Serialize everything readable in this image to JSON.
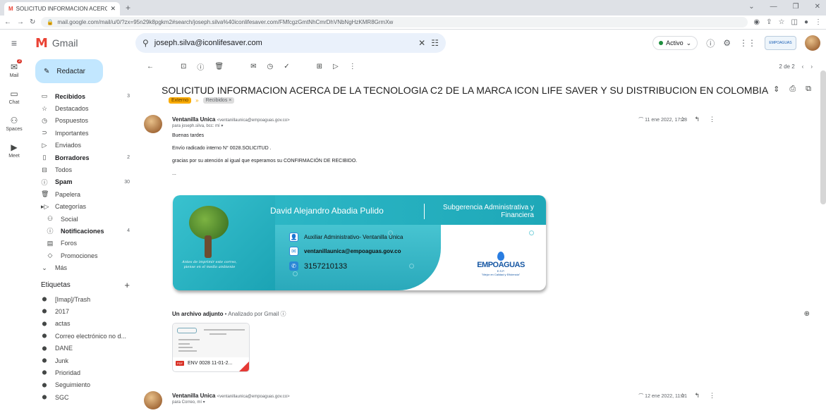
{
  "browser": {
    "tab_title": "SOLICITUD INFORMACION ACERC",
    "url": "mail.google.com/mail/u/0/?zx=95n29k8pgkm2#search/joseph.silva%40iconlifesaver.com/FMfcgzGmtNhCmrDhVNbNgHzKMR8GrmXw"
  },
  "header": {
    "app_name": "Gmail",
    "search_query": "joseph.silva@iconlifesaver.com",
    "status_label": "Activo",
    "brand_badge": "EMPOAGUAS"
  },
  "rail": [
    {
      "label": "Mail",
      "icon": "mail-icon",
      "badge": "3"
    },
    {
      "label": "Chat",
      "icon": "chat-icon"
    },
    {
      "label": "Spaces",
      "icon": "spaces-icon"
    },
    {
      "label": "Meet",
      "icon": "meet-icon"
    }
  ],
  "sidebar": {
    "compose_label": "Redactar",
    "items": [
      {
        "label": "Recibidos",
        "count": "3",
        "bold": true,
        "icon": "inbox-icon",
        "glyph": "▭"
      },
      {
        "label": "Destacados",
        "count": "",
        "icon": "star-icon",
        "glyph": "☆"
      },
      {
        "label": "Pospuestos",
        "count": "",
        "icon": "clock-icon",
        "glyph": "◷"
      },
      {
        "label": "Importantes",
        "count": "",
        "icon": "important-icon",
        "glyph": "⊃"
      },
      {
        "label": "Enviados",
        "count": "",
        "icon": "send-icon",
        "glyph": "▷"
      },
      {
        "label": "Borradores",
        "count": "2",
        "bold": true,
        "icon": "draft-icon",
        "glyph": "▯"
      },
      {
        "label": "Todos",
        "count": "",
        "icon": "all-mail-icon",
        "glyph": "⊟"
      },
      {
        "label": "Spam",
        "count": "30",
        "bold": true,
        "icon": "spam-icon",
        "glyph": "ⓘ"
      },
      {
        "label": "Papelera",
        "count": "",
        "icon": "trash-icon",
        "glyph": "🗑"
      },
      {
        "label": "Categorías",
        "count": "",
        "icon": "category-icon",
        "glyph": "▸▷"
      },
      {
        "label": "Social",
        "count": "",
        "sub": true,
        "icon": "people-icon",
        "glyph": "⚇"
      },
      {
        "label": "Notificaciones",
        "count": "4",
        "bold": true,
        "sub": true,
        "icon": "info-icon",
        "glyph": "ⓘ"
      },
      {
        "label": "Foros",
        "count": "",
        "sub": true,
        "icon": "forum-icon",
        "glyph": "▤"
      },
      {
        "label": "Promociones",
        "count": "",
        "sub": true,
        "icon": "tag-icon",
        "glyph": "◇"
      },
      {
        "label": "Más",
        "count": "",
        "icon": "chevron-down-icon",
        "glyph": "⌄"
      }
    ],
    "labels_title": "Etiquetas",
    "labels": [
      "[Imap]/Trash",
      "2017",
      "actas",
      "Correo electrónico no d...",
      "DANE",
      "Junk",
      "Prioridad",
      "Seguimiento",
      "SGC"
    ]
  },
  "thread": {
    "pager": "2 de 2",
    "subject": "SOLICITUD INFORMACION ACERCA DE LA TECNOLOGIA C2 DE LA MARCA ICON LIFE SAVER Y SU DISTRIBUCION EN COLOMBIA",
    "tag_external": "Externo",
    "tag_inbox": "Recibidos ×",
    "message1": {
      "sender_name": "Ventanilla Unica",
      "sender_email": "<ventanillaunica@empoaguas.gov.co>",
      "to": "para joseph.silva, bcc: mí ▾",
      "date": "11 ene 2022, 17:28",
      "greeting": "Buenas tardes",
      "line1": "Envío radicado interno N° 0028.SOLICITUD .",
      "line2": "gracias por su atención al igual que esperamos su CONFIRMACIÓN DE RECIBIDO.",
      "ellipsis": "..."
    },
    "signature": {
      "name": "David Alejandro Abadia Pulido",
      "dept": "Subgerencia Administrativa y Financiera",
      "role": "Auxiliar Administrativo- Ventanilla Única",
      "email": "ventanillaunica@empoaguas.gov.co",
      "phone": "3157210133",
      "motto": "Antes de imprimir este correo, piense en el medio ambiente",
      "org": "EMPOAGUAS",
      "org_suffix": "E.S.P.",
      "org_tagline": "\"Mejor en Calidad y Eficiencia\""
    },
    "attachment_header": "Un archivo adjunto",
    "attachment_scan": " • Analizado por Gmail ⓘ",
    "attachment_name": "ENV 0028 11-01-2...",
    "message2": {
      "sender_name": "Ventanilla Unica",
      "sender_email": "<ventanillaunica@empoaguas.gov.co>",
      "to": "para Correo, mí ▾",
      "date": "12 ene 2022, 11:01"
    }
  }
}
